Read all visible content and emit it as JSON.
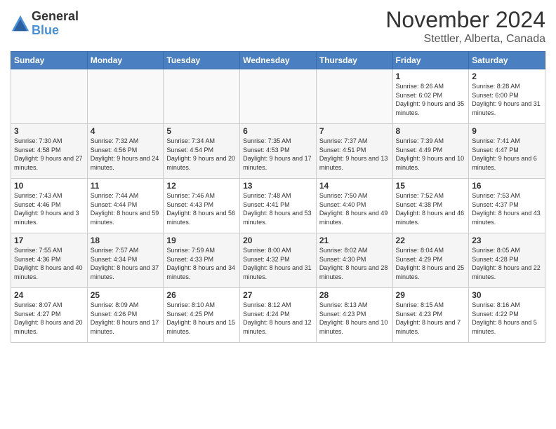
{
  "logo": {
    "general": "General",
    "blue": "Blue"
  },
  "header": {
    "month": "November 2024",
    "location": "Stettler, Alberta, Canada"
  },
  "days_of_week": [
    "Sunday",
    "Monday",
    "Tuesday",
    "Wednesday",
    "Thursday",
    "Friday",
    "Saturday"
  ],
  "weeks": [
    [
      {
        "day": "",
        "info": ""
      },
      {
        "day": "",
        "info": ""
      },
      {
        "day": "",
        "info": ""
      },
      {
        "day": "",
        "info": ""
      },
      {
        "day": "",
        "info": ""
      },
      {
        "day": "1",
        "info": "Sunrise: 8:26 AM\nSunset: 6:02 PM\nDaylight: 9 hours and 35 minutes."
      },
      {
        "day": "2",
        "info": "Sunrise: 8:28 AM\nSunset: 6:00 PM\nDaylight: 9 hours and 31 minutes."
      }
    ],
    [
      {
        "day": "3",
        "info": "Sunrise: 7:30 AM\nSunset: 4:58 PM\nDaylight: 9 hours and 27 minutes."
      },
      {
        "day": "4",
        "info": "Sunrise: 7:32 AM\nSunset: 4:56 PM\nDaylight: 9 hours and 24 minutes."
      },
      {
        "day": "5",
        "info": "Sunrise: 7:34 AM\nSunset: 4:54 PM\nDaylight: 9 hours and 20 minutes."
      },
      {
        "day": "6",
        "info": "Sunrise: 7:35 AM\nSunset: 4:53 PM\nDaylight: 9 hours and 17 minutes."
      },
      {
        "day": "7",
        "info": "Sunrise: 7:37 AM\nSunset: 4:51 PM\nDaylight: 9 hours and 13 minutes."
      },
      {
        "day": "8",
        "info": "Sunrise: 7:39 AM\nSunset: 4:49 PM\nDaylight: 9 hours and 10 minutes."
      },
      {
        "day": "9",
        "info": "Sunrise: 7:41 AM\nSunset: 4:47 PM\nDaylight: 9 hours and 6 minutes."
      }
    ],
    [
      {
        "day": "10",
        "info": "Sunrise: 7:43 AM\nSunset: 4:46 PM\nDaylight: 9 hours and 3 minutes."
      },
      {
        "day": "11",
        "info": "Sunrise: 7:44 AM\nSunset: 4:44 PM\nDaylight: 8 hours and 59 minutes."
      },
      {
        "day": "12",
        "info": "Sunrise: 7:46 AM\nSunset: 4:43 PM\nDaylight: 8 hours and 56 minutes."
      },
      {
        "day": "13",
        "info": "Sunrise: 7:48 AM\nSunset: 4:41 PM\nDaylight: 8 hours and 53 minutes."
      },
      {
        "day": "14",
        "info": "Sunrise: 7:50 AM\nSunset: 4:40 PM\nDaylight: 8 hours and 49 minutes."
      },
      {
        "day": "15",
        "info": "Sunrise: 7:52 AM\nSunset: 4:38 PM\nDaylight: 8 hours and 46 minutes."
      },
      {
        "day": "16",
        "info": "Sunrise: 7:53 AM\nSunset: 4:37 PM\nDaylight: 8 hours and 43 minutes."
      }
    ],
    [
      {
        "day": "17",
        "info": "Sunrise: 7:55 AM\nSunset: 4:36 PM\nDaylight: 8 hours and 40 minutes."
      },
      {
        "day": "18",
        "info": "Sunrise: 7:57 AM\nSunset: 4:34 PM\nDaylight: 8 hours and 37 minutes."
      },
      {
        "day": "19",
        "info": "Sunrise: 7:59 AM\nSunset: 4:33 PM\nDaylight: 8 hours and 34 minutes."
      },
      {
        "day": "20",
        "info": "Sunrise: 8:00 AM\nSunset: 4:32 PM\nDaylight: 8 hours and 31 minutes."
      },
      {
        "day": "21",
        "info": "Sunrise: 8:02 AM\nSunset: 4:30 PM\nDaylight: 8 hours and 28 minutes."
      },
      {
        "day": "22",
        "info": "Sunrise: 8:04 AM\nSunset: 4:29 PM\nDaylight: 8 hours and 25 minutes."
      },
      {
        "day": "23",
        "info": "Sunrise: 8:05 AM\nSunset: 4:28 PM\nDaylight: 8 hours and 22 minutes."
      }
    ],
    [
      {
        "day": "24",
        "info": "Sunrise: 8:07 AM\nSunset: 4:27 PM\nDaylight: 8 hours and 20 minutes."
      },
      {
        "day": "25",
        "info": "Sunrise: 8:09 AM\nSunset: 4:26 PM\nDaylight: 8 hours and 17 minutes."
      },
      {
        "day": "26",
        "info": "Sunrise: 8:10 AM\nSunset: 4:25 PM\nDaylight: 8 hours and 15 minutes."
      },
      {
        "day": "27",
        "info": "Sunrise: 8:12 AM\nSunset: 4:24 PM\nDaylight: 8 hours and 12 minutes."
      },
      {
        "day": "28",
        "info": "Sunrise: 8:13 AM\nSunset: 4:23 PM\nDaylight: 8 hours and 10 minutes."
      },
      {
        "day": "29",
        "info": "Sunrise: 8:15 AM\nSunset: 4:23 PM\nDaylight: 8 hours and 7 minutes."
      },
      {
        "day": "30",
        "info": "Sunrise: 8:16 AM\nSunset: 4:22 PM\nDaylight: 8 hours and 5 minutes."
      }
    ]
  ]
}
